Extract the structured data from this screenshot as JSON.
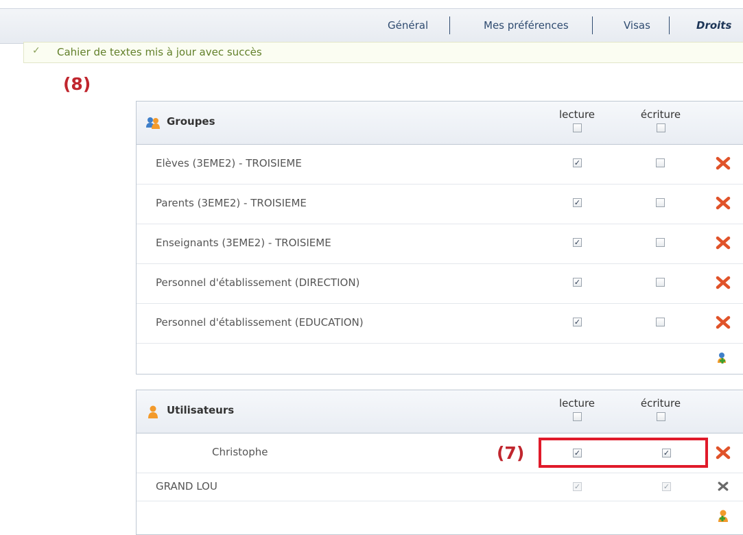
{
  "tabs": [
    {
      "label": "Général"
    },
    {
      "label": "Mes préférences"
    },
    {
      "label": "Visas"
    },
    {
      "label": "Droits"
    }
  ],
  "banner": {
    "message": "Cahier de textes mis à jour avec succès",
    "icon": "check-icon"
  },
  "annotations": {
    "eight": "(8)",
    "seven": "(7)"
  },
  "groups": {
    "title": "Groupes",
    "col_read": "lecture",
    "col_write": "écriture",
    "rows": [
      {
        "label": "Elèves (3EME2) - TROISIEME",
        "read": true,
        "write": false
      },
      {
        "label": "Parents (3EME2) - TROISIEME",
        "read": true,
        "write": false
      },
      {
        "label": "Enseignants (3EME2) - TROISIEME",
        "read": true,
        "write": false
      },
      {
        "label": "Personnel d'établissement (DIRECTION)",
        "read": true,
        "write": false
      },
      {
        "label": "Personnel d'établissement (EDUCATION)",
        "read": true,
        "write": false
      }
    ]
  },
  "users": {
    "title": "Utilisateurs",
    "col_read": "lecture",
    "col_write": "écriture",
    "rows": [
      {
        "label": "Christophe",
        "read": true,
        "write": true,
        "disabled": false
      },
      {
        "label": "GRAND LOU",
        "read": true,
        "write": true,
        "disabled": true
      }
    ]
  },
  "colors": {
    "accent": "#2f4b70",
    "success": "#62802a",
    "annotation": "#e01a2a",
    "delete": "#e0532a"
  }
}
